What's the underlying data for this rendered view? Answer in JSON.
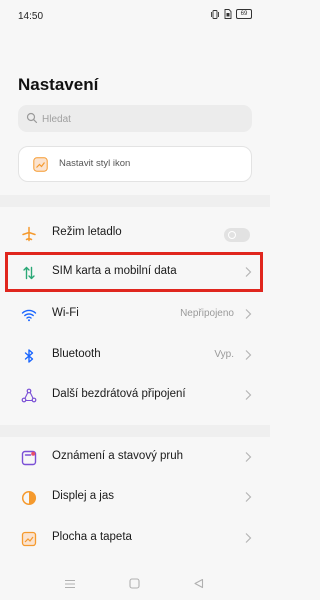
{
  "status_bar": {
    "time": "14:50",
    "battery": "69"
  },
  "header": {
    "title": "Nastavení"
  },
  "search": {
    "placeholder": "Hledat"
  },
  "icon_style_card": {
    "label": "Nastavit styl ikon"
  },
  "rows": [
    {
      "label": "Režim letadlo",
      "icon": "airplane-icon",
      "control": "toggle",
      "toggle_on": false
    },
    {
      "label": "SIM karta a mobilní data",
      "icon": "sim-data-icon"
    },
    {
      "label": "Wi-Fi",
      "value": "Nepřipojeno",
      "icon": "wifi-icon"
    },
    {
      "label": "Bluetooth",
      "value": "Vyp.",
      "icon": "bluetooth-icon"
    },
    {
      "label": "Další bezdrátová připojení",
      "icon": "connections-icon"
    },
    {
      "label": "Oznámení a stavový pruh",
      "icon": "notification-icon"
    },
    {
      "label": "Displej a jas",
      "icon": "display-icon"
    },
    {
      "label": "Plocha a tapeta",
      "icon": "wallpaper-icon"
    }
  ],
  "colors": {
    "highlight": "#e0261e",
    "accent_blue": "#1a66ff",
    "orange": "#f59a2e",
    "purple": "#7a4fd6",
    "red_pink": "#e84d6b"
  }
}
